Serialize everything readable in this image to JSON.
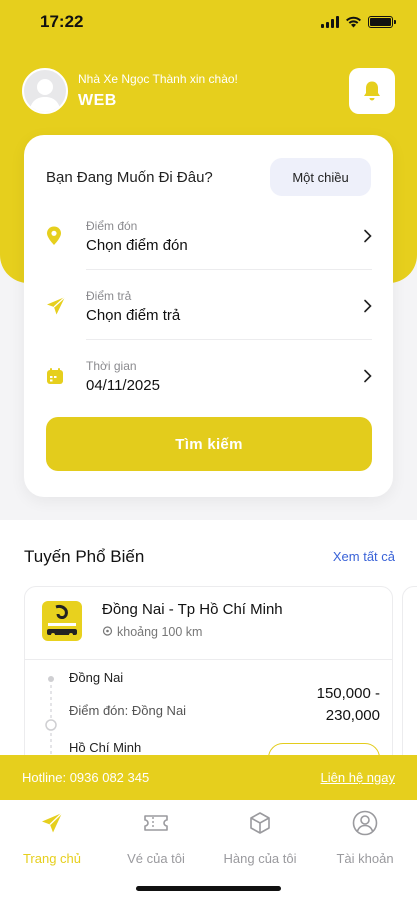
{
  "status_bar": {
    "time": "17:22"
  },
  "header": {
    "greeting": "Nhà Xe Ngọc Thành xin chào!",
    "user_name": "WEB"
  },
  "search_card": {
    "title": "Bạn Đang Muốn Đi Đâu?",
    "trip_type": "Một chiều",
    "fields": [
      {
        "icon": "location-pin-icon",
        "label": "Điểm đón",
        "value": "Chọn điểm đón"
      },
      {
        "icon": "send-plane-icon",
        "label": "Điểm trả",
        "value": "Chọn điểm trả"
      },
      {
        "icon": "calendar-icon",
        "label": "Thời gian",
        "value": "04/11/2025"
      }
    ],
    "search_label": "Tìm kiếm"
  },
  "popular_routes": {
    "title": "Tuyến Phổ Biến",
    "see_all": "Xem tất cả",
    "route": {
      "name": "Đồng Nai - Tp Hồ Chí Minh",
      "distance": "khoảng 100 km",
      "from": "Đồng Nai",
      "pickup": "Điểm đón: Đồng Nai",
      "to": "Hồ Chí Minh",
      "price_min": "150,000 -",
      "price_max": "230,000"
    }
  },
  "hotline": {
    "text": "Hotline: 0936 082 345",
    "contact_label": "Liên hệ ngay"
  },
  "tabs": [
    {
      "label": "Trang chủ",
      "icon": "send-plane-icon",
      "active": true
    },
    {
      "label": "Vé của tôi",
      "icon": "ticket-icon",
      "active": false
    },
    {
      "label": "Hàng của tôi",
      "icon": "box-icon",
      "active": false
    },
    {
      "label": "Tài khoản",
      "icon": "user-icon",
      "active": false
    }
  ],
  "colors": {
    "brand": "#e6cf1d",
    "link": "#3a63d8",
    "chip_bg": "#eef0fa"
  }
}
